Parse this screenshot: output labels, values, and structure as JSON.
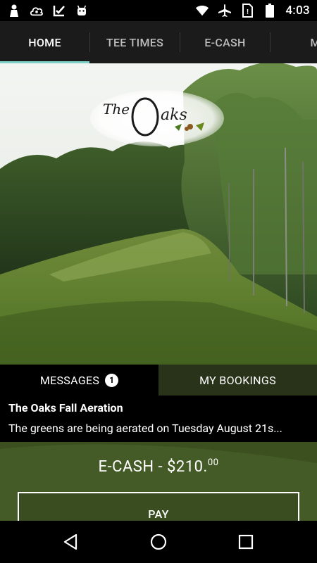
{
  "status_bar": {
    "time": "4:03",
    "left_icons": [
      "person-icon",
      "cloud-icon",
      "checkbox-icon",
      "android-icon"
    ],
    "right_icons": [
      "wifi-icon",
      "airplane-icon",
      "sim-icon",
      "battery-icon"
    ]
  },
  "tabs": [
    {
      "label": "HOME",
      "active": true
    },
    {
      "label": "TEE TIMES",
      "active": false
    },
    {
      "label": "E-CASH",
      "active": false
    },
    {
      "label": "M",
      "active": false
    }
  ],
  "hero": {
    "logo_text": "The Oaks"
  },
  "messages_panel": {
    "tab_messages": "MESSAGES",
    "messages_count": "1",
    "tab_bookings": "MY BOOKINGS",
    "message_title": "The Oaks Fall Aeration",
    "message_body": "The greens are being aerated on Tuesday August 21s..."
  },
  "ecash": {
    "label": "E-CASH - $210.",
    "cents": "00",
    "pay_label": "PAY"
  },
  "nav": [
    "back-icon",
    "home-icon",
    "recents-icon"
  ],
  "colors": {
    "accent": "#7fd0c8",
    "tabbar_bg": "#1b1b1b"
  }
}
